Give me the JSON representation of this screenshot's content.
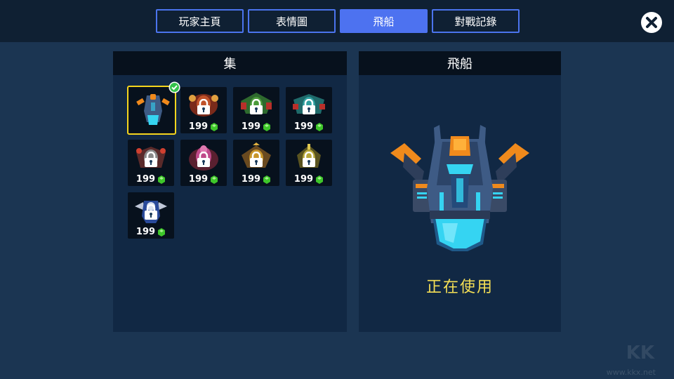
{
  "tabs": [
    {
      "label": "玩家主頁",
      "active": false
    },
    {
      "label": "表情圖",
      "active": false
    },
    {
      "label": "飛船",
      "active": true
    },
    {
      "label": "對戰記錄",
      "active": false
    }
  ],
  "close_icon": "close-icon",
  "collection": {
    "title": "集",
    "items": [
      {
        "ship": "blue-cyan-ship",
        "selected": true,
        "locked": false,
        "price": ""
      },
      {
        "ship": "red-brown-ship",
        "selected": false,
        "locked": true,
        "price": "199"
      },
      {
        "ship": "green-red-ship",
        "selected": false,
        "locked": true,
        "price": "199"
      },
      {
        "ship": "teal-red-ship",
        "selected": false,
        "locked": true,
        "price": "199"
      },
      {
        "ship": "red-grey-ship",
        "selected": false,
        "locked": true,
        "price": "199"
      },
      {
        "ship": "pink-purple-ship",
        "selected": false,
        "locked": true,
        "price": "199"
      },
      {
        "ship": "gold-brown-ship",
        "selected": false,
        "locked": true,
        "price": "199"
      },
      {
        "ship": "olive-gold-ship",
        "selected": false,
        "locked": true,
        "price": "199"
      },
      {
        "ship": "blue-silver-ship",
        "selected": false,
        "locked": true,
        "price": "199"
      }
    ]
  },
  "detail": {
    "title": "飛船",
    "status": "正在使用",
    "ship": "blue-cyan-ship"
  },
  "watermark": {
    "logo_text": "KK",
    "url": "www.kkx.net"
  },
  "colors": {
    "background": "#1b3552",
    "topbar": "#0f2033",
    "tab_border": "#4b74ee",
    "tab_active": "#4d72f0",
    "panel": "#112844",
    "panel_header": "#07111d",
    "selected_border": "#f5d51d",
    "status_text": "#f5df55",
    "gem": "#3ec62a"
  }
}
